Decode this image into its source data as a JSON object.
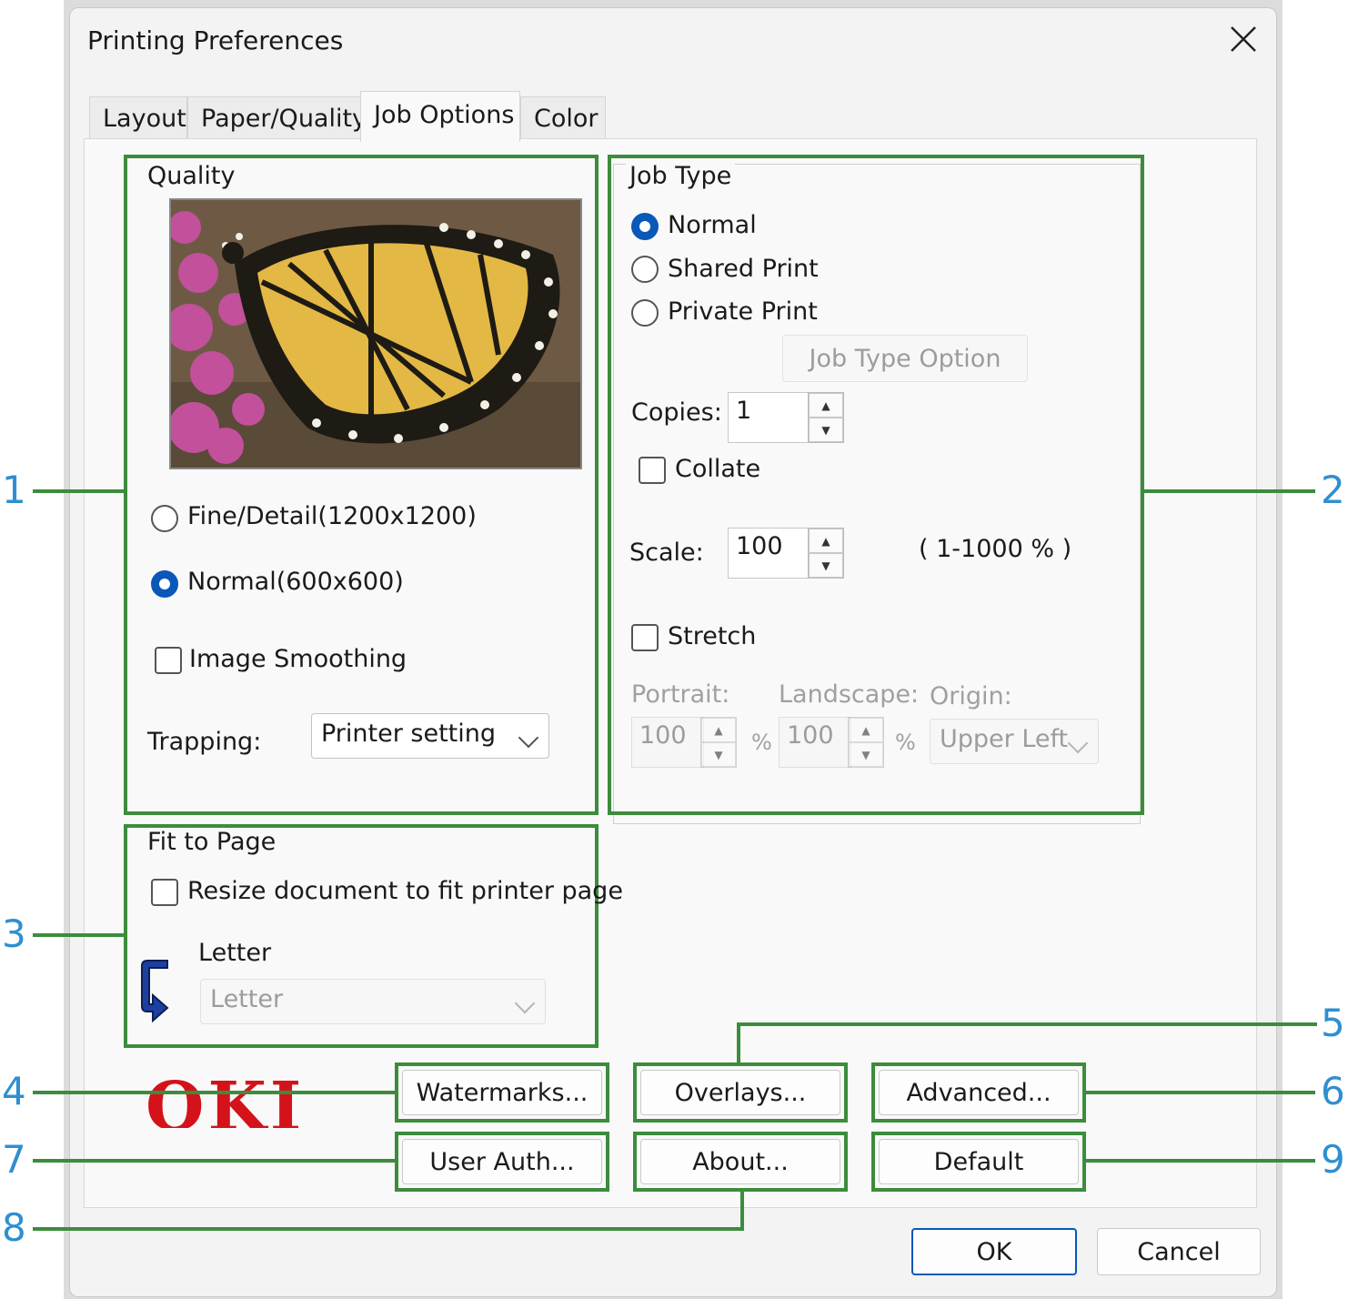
{
  "window": {
    "title": "Printing Preferences"
  },
  "tabs": [
    {
      "label": "Layout"
    },
    {
      "label": "Paper/Quality"
    },
    {
      "label": "Job Options"
    },
    {
      "label": "Color"
    }
  ],
  "quality": {
    "legend": "Quality",
    "fine_label": "Fine/Detail(1200x1200)",
    "normal_label": "Normal(600x600)",
    "selected": "Normal(600x600)",
    "smoothing_label": "Image Smoothing",
    "trapping_label": "Trapping:",
    "trapping_value": "Printer setting"
  },
  "job_type": {
    "legend": "Job Type",
    "normal_label": "Normal",
    "shared_label": "Shared Print",
    "private_label": "Private Print",
    "selected": "Normal",
    "option_button": "Job Type Option",
    "copies_label": "Copies:",
    "copies_value": "1",
    "collate_label": "Collate",
    "scale_label": "Scale:",
    "scale_value": "100",
    "scale_range": "( 1-1000 % )",
    "stretch_label": "Stretch",
    "portrait_label": "Portrait:",
    "portrait_value": "100",
    "landscape_label": "Landscape:",
    "landscape_value": "100",
    "percent": "%",
    "origin_label": "Origin:",
    "origin_value": "Upper Left"
  },
  "fit_to_page": {
    "legend": "Fit to Page",
    "resize_label": "Resize document to fit printer page",
    "source_label": "Letter",
    "target_value": "Letter"
  },
  "brand": {
    "logo_text": "OKI",
    "logo_color": "#d4121a"
  },
  "buttons": {
    "watermarks": "Watermarks...",
    "overlays": "Overlays...",
    "advanced": "Advanced...",
    "user_auth": "User Auth...",
    "about": "About...",
    "default": "Default",
    "ok": "OK",
    "cancel": "Cancel"
  },
  "callouts": {
    "n1": "1",
    "n2": "2",
    "n3": "3",
    "n4": "4",
    "n5": "5",
    "n6": "6",
    "n7": "7",
    "n8": "8",
    "n9": "9"
  },
  "colors": {
    "highlight": "#3c8c3c",
    "callout": "#2f8fd0",
    "accent": "#0a58b8"
  }
}
